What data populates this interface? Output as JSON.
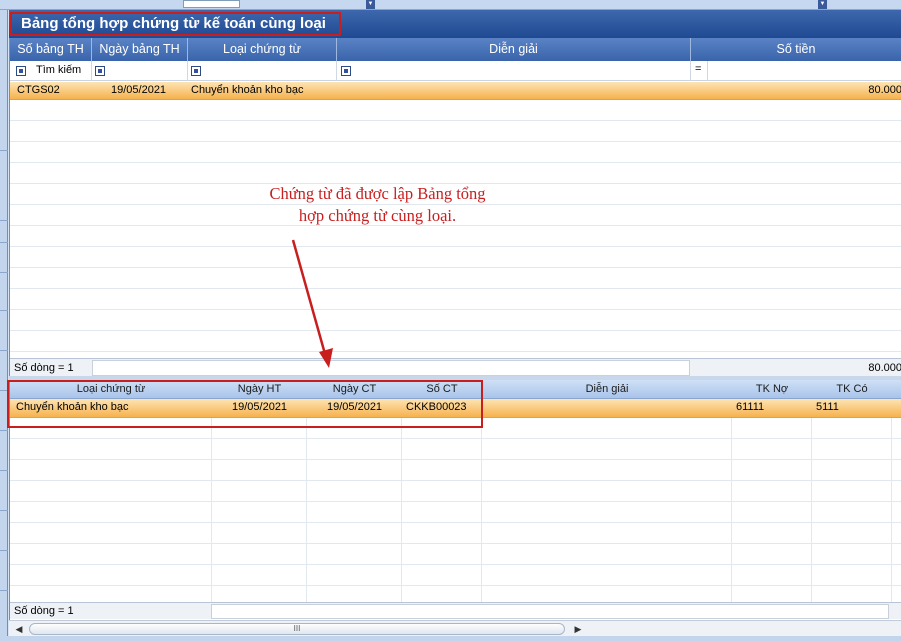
{
  "window": {
    "title": "Bảng tổng hợp chứng từ kế toán cùng loại"
  },
  "summary_grid": {
    "columns": [
      "Số bảng TH",
      "Ngày bảng TH",
      "Loại chứng từ",
      "Diễn giải",
      "Số tiền"
    ],
    "filter": {
      "search_label": "Tìm kiếm",
      "amount_operator": "="
    },
    "rows": [
      {
        "so_bang_th": "CTGS02",
        "ngay_bang_th": "19/05/2021",
        "loai_chung_tu": "Chuyển khoản kho bạc",
        "dien_giai": "",
        "so_tien": "80.000"
      }
    ],
    "footer": {
      "row_count_label": "Số dòng = 1",
      "total": "80.000"
    }
  },
  "annotation": {
    "callout_line1": "Chứng từ đã được lập Bảng tổng",
    "callout_line2": "hợp chứng từ cùng loại.",
    "color": "#c81e1e"
  },
  "detail_grid": {
    "columns": [
      "Loại chứng từ",
      "Ngày HT",
      "Ngày CT",
      "Số CT",
      "Diễn giải",
      "TK Nợ",
      "TK Có"
    ],
    "rows": [
      {
        "loai_chung_tu": "Chuyển khoản kho bạc",
        "ngay_ht": "19/05/2021",
        "ngay_ct": "19/05/2021",
        "so_ct": "CKKB00023",
        "dien_giai": "",
        "tk_no": "61111",
        "tk_co": "5111"
      }
    ],
    "footer": {
      "row_count_label": "Số dòng = 1"
    },
    "scrollbar_grip": "III"
  },
  "colors": {
    "header_blue": "#3a64aa",
    "selected_row": "#f6b24e",
    "highlight_red": "#c81e1e"
  }
}
